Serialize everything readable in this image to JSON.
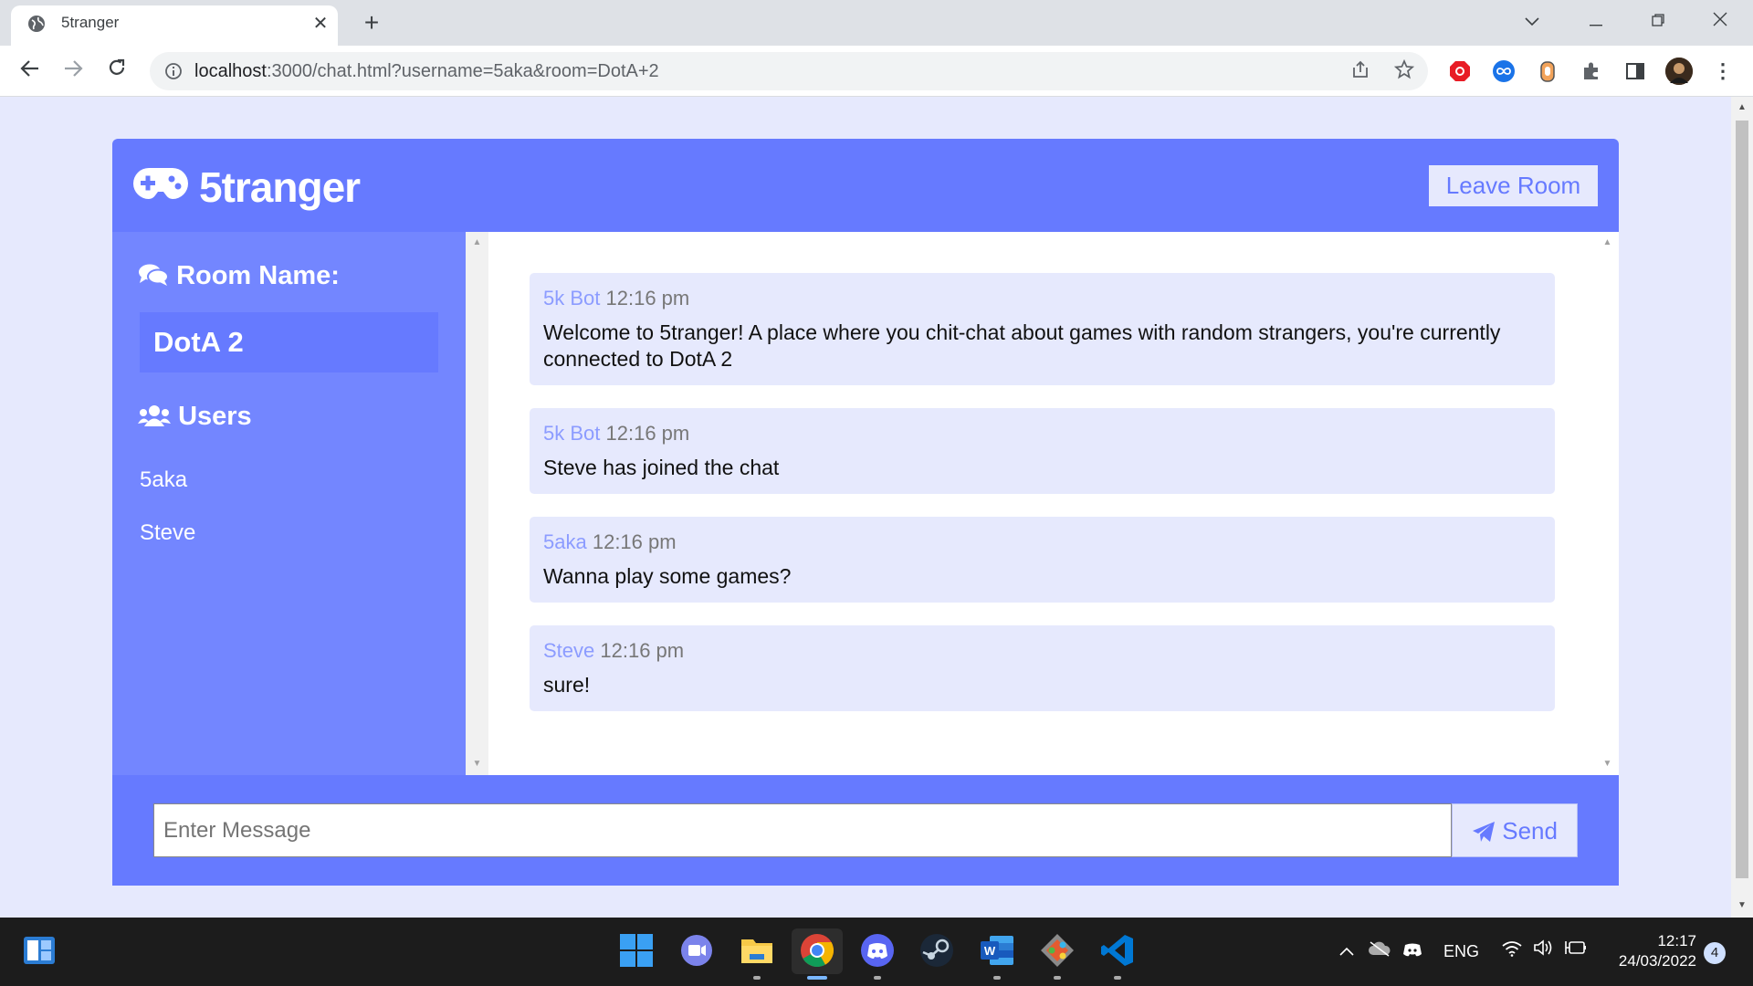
{
  "browser": {
    "tab_title": "5tranger",
    "url_host": "localhost",
    "url_rest": ":3000/chat.html?username=5aka&room=DotA+2",
    "new_tab": "+",
    "close": "✕"
  },
  "header": {
    "logo": "5tranger",
    "leave_label": "Leave Room"
  },
  "sidebar": {
    "room_title": "Room Name:",
    "room_name": "DotA 2",
    "users_title": "Users",
    "users": [
      "5aka",
      "Steve"
    ]
  },
  "messages": [
    {
      "author": "5k Bot",
      "time": "12:16 pm",
      "text": "Welcome to 5tranger! A place where you chit-chat about games with random strangers, you're currently connected to DotA 2"
    },
    {
      "author": "5k Bot",
      "time": "12:16 pm",
      "text": "Steve has joined the chat"
    },
    {
      "author": "5aka",
      "time": "12:16 pm",
      "text": "Wanna play some games?"
    },
    {
      "author": "Steve",
      "time": "12:16 pm",
      "text": "sure!"
    }
  ],
  "footer": {
    "input_placeholder": "Enter Message",
    "send_label": "Send"
  },
  "taskbar": {
    "language": "ENG",
    "time": "12:17",
    "date": "24/03/2022",
    "notifications": "4"
  },
  "colors": {
    "primary": "#667aff",
    "sidebar": "#7386ff",
    "light": "#e6e9fd"
  }
}
